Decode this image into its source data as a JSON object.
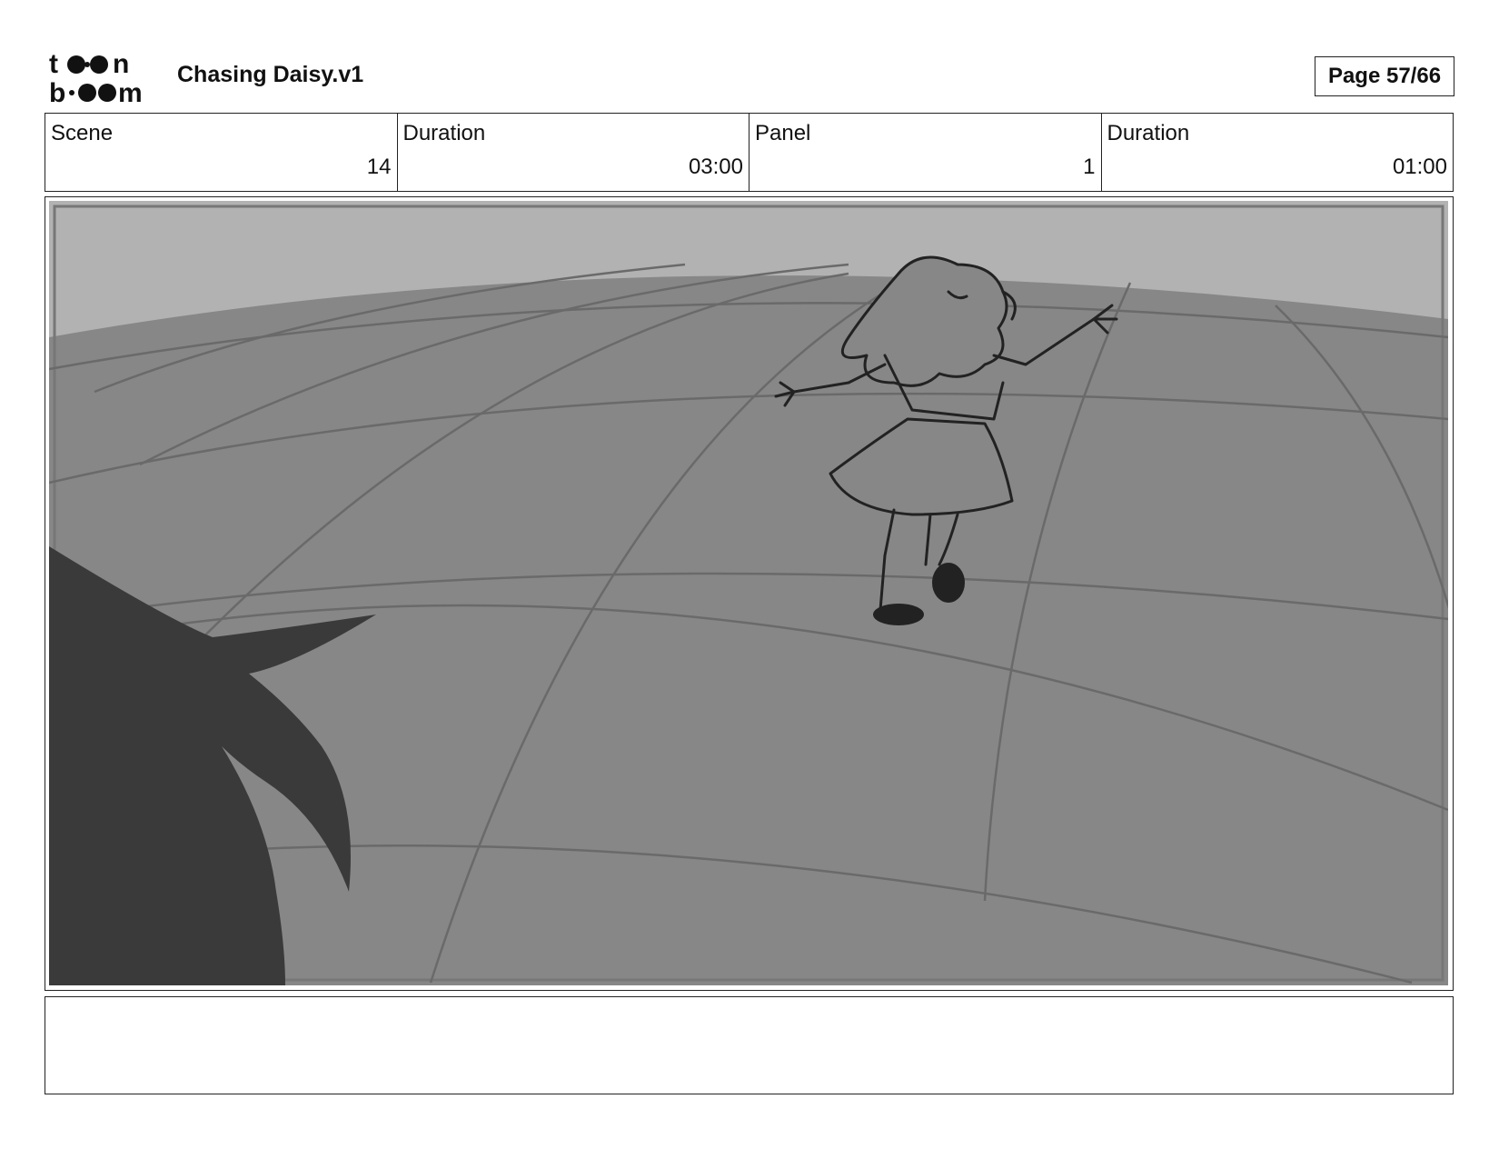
{
  "header": {
    "logo_text": "toonboom",
    "project_title": "Chasing Daisy.v1",
    "page_label": "Page 57/66"
  },
  "info": {
    "scene_label": "Scene",
    "scene_value": "14",
    "scene_duration_label": "Duration",
    "scene_duration_value": "03:00",
    "panel_label": "Panel",
    "panel_value": "1",
    "panel_duration_label": "Duration",
    "panel_duration_value": "01:00"
  },
  "panel": {
    "colors": {
      "sky": "#b2b2b2",
      "ground": "#878787",
      "grid_lines": "#6a6a6a",
      "foreground_hair": "#3a3a3a",
      "line_art": "#222222"
    }
  },
  "caption": {
    "text": ""
  }
}
